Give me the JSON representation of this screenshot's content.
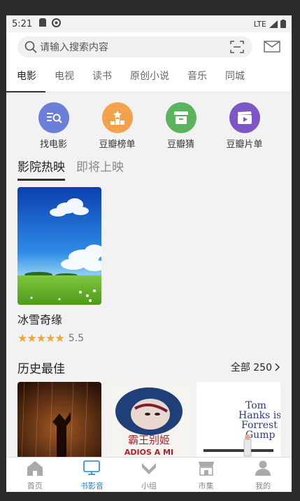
{
  "status": {
    "time": "5:21",
    "network": "LTE"
  },
  "search": {
    "placeholder": "请输入搜索内容"
  },
  "tabs": [
    {
      "label": "电影",
      "active": true
    },
    {
      "label": "电视"
    },
    {
      "label": "读书"
    },
    {
      "label": "原创小说"
    },
    {
      "label": "音乐"
    },
    {
      "label": "同城"
    }
  ],
  "quick_actions": [
    {
      "label": "找电影",
      "color": "#6b7fd9"
    },
    {
      "label": "豆瓣榜单",
      "color": "#f1a24a"
    },
    {
      "label": "豆瓣猜",
      "color": "#5cb35e"
    },
    {
      "label": "豆瓣片单",
      "color": "#7e57c7"
    }
  ],
  "section_tabs": [
    {
      "label": "影院热映",
      "active": true
    },
    {
      "label": "即将上映"
    }
  ],
  "movie": {
    "title": "冰雪奇缘",
    "stars": "★★★★★",
    "score": "5.5",
    "rating_fraction": 0.55
  },
  "history": {
    "title": "历史最佳",
    "all_label": "全部 250"
  },
  "posters": {
    "poster2_text_cn": "霸王别姬",
    "poster2_text_en": "ADIOS A MI",
    "poster3_text": "Tom\nHanks is\nForrest\nGump"
  },
  "bottom_nav": [
    {
      "label": "首页"
    },
    {
      "label": "书影音",
      "active": true
    },
    {
      "label": "小组"
    },
    {
      "label": "市集"
    },
    {
      "label": "我的"
    }
  ],
  "colors": {
    "accent": "#1c86d6",
    "star": "#f3a636"
  }
}
